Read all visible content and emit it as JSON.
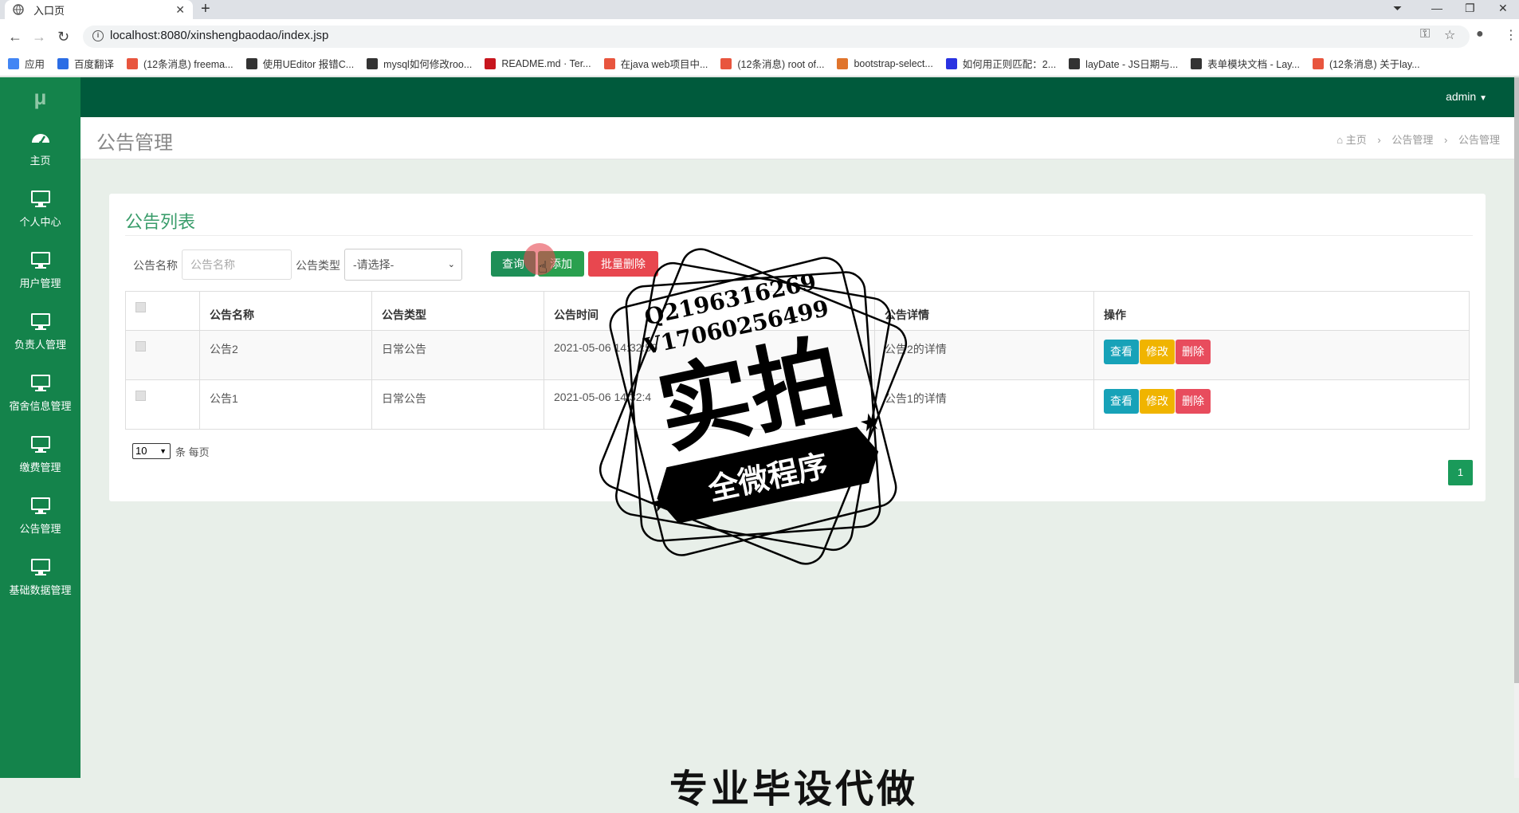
{
  "browser": {
    "tab_title": "入口页",
    "url": "localhost:8080/xinshengbaodao/index.jsp",
    "bookmarks": [
      {
        "label": "应用",
        "color": "#4285f4"
      },
      {
        "label": "百度翻译",
        "color": "#2b6de5"
      },
      {
        "label": "(12条消息) freema...",
        "color": "#e8553e"
      },
      {
        "label": "使用UEditor 报错C...",
        "color": "#333333"
      },
      {
        "label": "mysql如何修改roo...",
        "color": "#333333"
      },
      {
        "label": "README.md · Ter...",
        "color": "#c7161e"
      },
      {
        "label": "在java web项目中...",
        "color": "#e8553e"
      },
      {
        "label": "(12条消息) root of...",
        "color": "#e8553e"
      },
      {
        "label": "bootstrap-select...",
        "color": "#e0742c"
      },
      {
        "label": "如何用正则匹配：2...",
        "color": "#2932e1"
      },
      {
        "label": "layDate - JS日期与...",
        "color": "#333333"
      },
      {
        "label": "表单模块文档 - Lay...",
        "color": "#333333"
      },
      {
        "label": "(12条消息) 关于lay...",
        "color": "#e8553e"
      }
    ]
  },
  "app": {
    "logo": "μ",
    "user": "admin",
    "sidebar": [
      {
        "label": "主页",
        "icon": "dashboard-icon"
      },
      {
        "label": "个人中心",
        "icon": "monitor-icon"
      },
      {
        "label": "用户管理",
        "icon": "monitor-icon"
      },
      {
        "label": "负责人管理",
        "icon": "monitor-icon"
      },
      {
        "label": "宿舍信息管理",
        "icon": "monitor-icon"
      },
      {
        "label": "缴费管理",
        "icon": "monitor-icon"
      },
      {
        "label": "公告管理",
        "icon": "monitor-icon"
      },
      {
        "label": "基础数据管理",
        "icon": "monitor-icon"
      }
    ],
    "page_title": "公告管理",
    "breadcrumb": [
      "主页",
      "公告管理",
      "公告管理"
    ]
  },
  "panel": {
    "title": "公告列表",
    "search": {
      "name_label": "公告名称",
      "name_placeholder": "公告名称",
      "type_label": "公告类型",
      "type_selected": "-请选择-"
    },
    "buttons": {
      "query": "查询",
      "add": "添加",
      "batch_delete": "批量删除"
    },
    "columns": [
      "公告名称",
      "公告类型",
      "公告时间",
      "公告详情",
      "操作"
    ],
    "rows": [
      {
        "name": "公告2",
        "type": "日常公告",
        "time": "2021-05-06 14:32:50",
        "detail": "公告2的详情"
      },
      {
        "name": "公告1",
        "type": "日常公告",
        "time": "2021-05-06 14:32:4",
        "detail": "公告1的详情"
      }
    ],
    "row_actions": {
      "view": "查看",
      "edit": "修改",
      "delete": "删除"
    },
    "page_size": "10",
    "page_size_suffix": "条 每页",
    "current_page": "1"
  },
  "watermark": {
    "line1": "Q2196316269",
    "line2": "V17060256499",
    "main": "实拍",
    "banner": "全微程序"
  },
  "bottom_text": "专业毕设代做",
  "colors": {
    "sidebar": "#14834b",
    "topnav": "#005a3c",
    "query": "#1e8f57",
    "add": "#2aa04f",
    "batch_delete": "#e8474f",
    "view": "#17a2b8",
    "edit": "#f0b400",
    "delete": "#e84c5d"
  }
}
